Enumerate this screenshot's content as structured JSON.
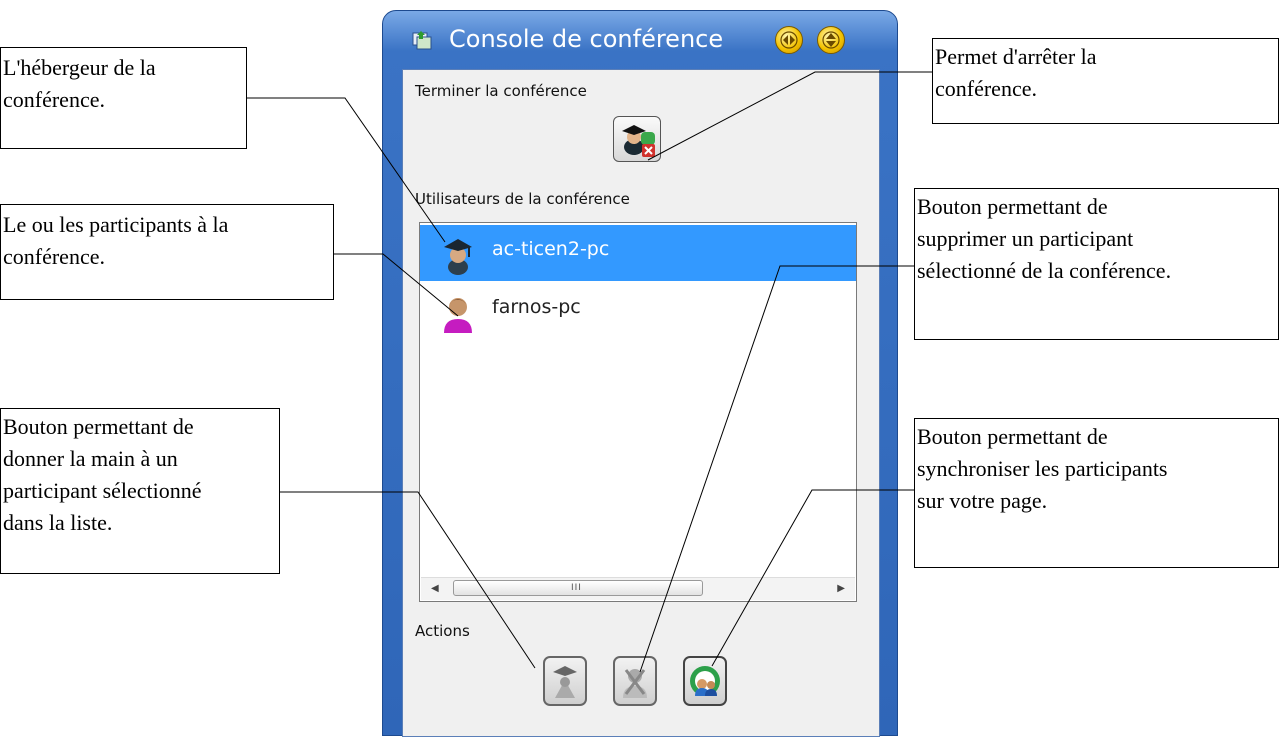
{
  "window": {
    "title": "Console de conférence",
    "sections": {
      "end_label": "Terminer la conférence",
      "users_label": "Utilisateurs de la conférence",
      "actions_label": "Actions"
    },
    "users": [
      {
        "name": "ac-ticen2-pc",
        "role": "host",
        "selected": true,
        "icon": "host-user-icon"
      },
      {
        "name": "farnos-pc",
        "role": "participant",
        "selected": false,
        "icon": "participant-user-icon"
      }
    ],
    "scrollbar_grip": "III",
    "colors": {
      "selection": "#3399ff",
      "titlebar": "#3a73c5",
      "panel": "#f0f0f0"
    }
  },
  "annotations": {
    "host": [
      "L'hébergeur de la",
      "conférence."
    ],
    "participants": [
      "Le ou les participants à la",
      "conférence."
    ],
    "give_hand": [
      "Bouton permettant de",
      "donner la main à un",
      "participant sélectionné",
      "dans la liste."
    ],
    "stop": [
      "Permet d'arrêter la",
      "conférence."
    ],
    "remove": [
      "Bouton permettant de",
      "supprimer un participant",
      "sélectionné de la conférence."
    ],
    "sync": [
      "Bouton permettant de",
      "synchroniser les participants",
      "sur votre page."
    ]
  }
}
